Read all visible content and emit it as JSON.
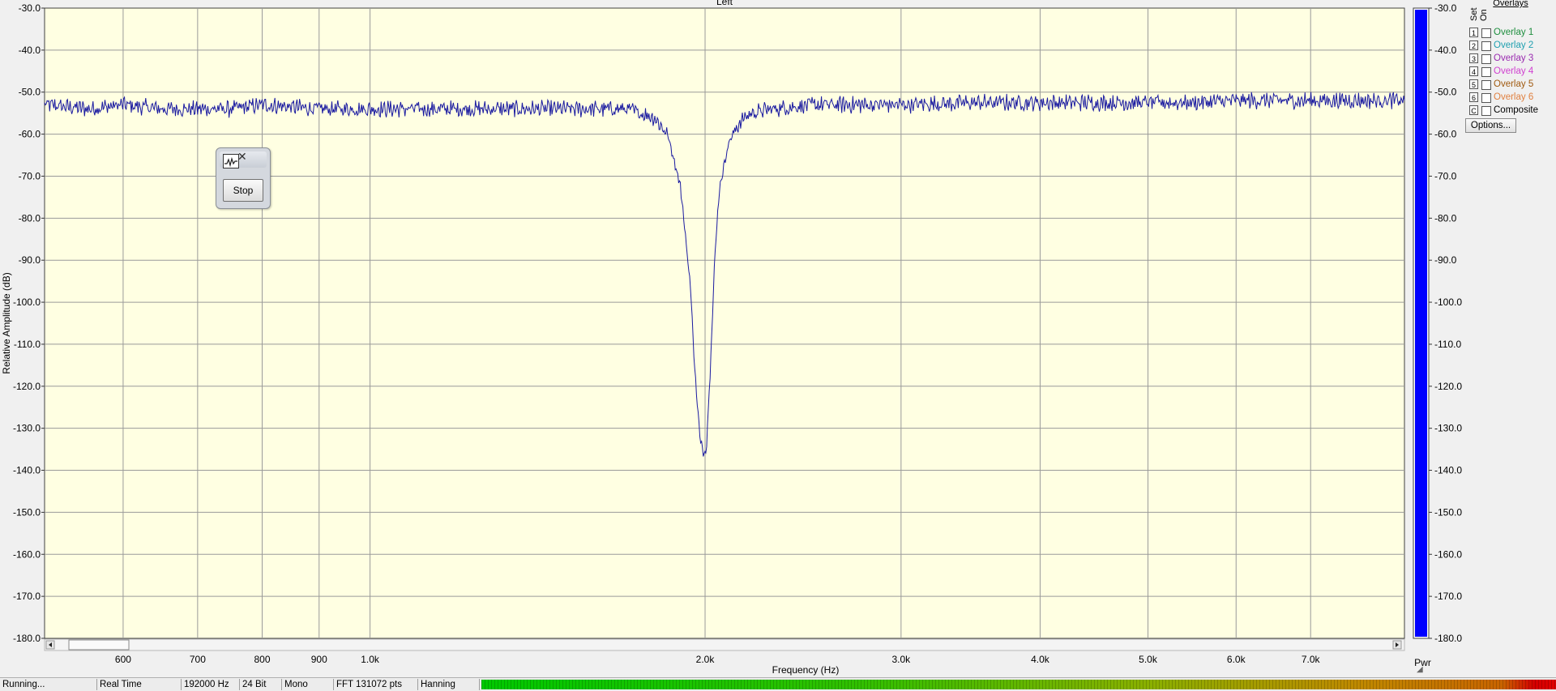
{
  "window": {
    "chart_title": "Left"
  },
  "chart_data": {
    "type": "line",
    "title": "Left",
    "xlabel": "Frequency (Hz)",
    "ylabel": "Relative Amplitude (dB)",
    "x_scale": "log",
    "xlim": [
      510,
      8500
    ],
    "ylim": [
      -180,
      -30
    ],
    "x_ticks": [
      {
        "value": 600,
        "label": "600"
      },
      {
        "value": 700,
        "label": "700"
      },
      {
        "value": 800,
        "label": "800"
      },
      {
        "value": 900,
        "label": "900"
      },
      {
        "value": 1000,
        "label": "1.0k"
      },
      {
        "value": 2000,
        "label": "2.0k"
      },
      {
        "value": 3000,
        "label": "3.0k"
      },
      {
        "value": 4000,
        "label": "4.0k"
      },
      {
        "value": 5000,
        "label": "5.0k"
      },
      {
        "value": 6000,
        "label": "6.0k"
      },
      {
        "value": 7000,
        "label": "7.0k"
      }
    ],
    "y_ticks": [
      {
        "value": -30,
        "label": "-30.0"
      },
      {
        "value": -40,
        "label": "-40.0"
      },
      {
        "value": -50,
        "label": "-50.0"
      },
      {
        "value": -60,
        "label": "-60.0"
      },
      {
        "value": -70,
        "label": "-70.0"
      },
      {
        "value": -80,
        "label": "-80.0"
      },
      {
        "value": -90,
        "label": "-90.0"
      },
      {
        "value": -100,
        "label": "-100.0"
      },
      {
        "value": -110,
        "label": "-110.0"
      },
      {
        "value": -120,
        "label": "-120.0"
      },
      {
        "value": -130,
        "label": "-130.0"
      },
      {
        "value": -140,
        "label": "-140.0"
      },
      {
        "value": -150,
        "label": "-150.0"
      },
      {
        "value": -160,
        "label": "-160.0"
      },
      {
        "value": -170,
        "label": "-170.0"
      },
      {
        "value": -180,
        "label": "-180.0"
      }
    ],
    "grid": true,
    "series": [
      {
        "color": "#1a1aa0",
        "x": [
          510,
          560,
          600,
          650,
          700,
          750,
          800,
          900,
          1000,
          1100,
          1200,
          1300,
          1400,
          1500,
          1600,
          1700,
          1800,
          1850,
          1900,
          1940,
          1960,
          1980,
          1995,
          2005,
          2020,
          2040,
          2060,
          2100,
          2150,
          2200,
          2300,
          2500,
          2750,
          3000,
          3500,
          4000,
          4500,
          5000,
          5500,
          6000,
          6500,
          7000,
          7500,
          8000,
          8500
        ],
        "y": [
          -53,
          -54,
          -53,
          -54,
          -54,
          -54,
          -53,
          -54,
          -54,
          -54,
          -54,
          -54,
          -54,
          -54,
          -54,
          -54,
          -56,
          -60,
          -72,
          -96,
          -118,
          -133,
          -136,
          -135,
          -118,
          -90,
          -73,
          -62,
          -57,
          -55,
          -54,
          -53,
          -53,
          -53,
          -52.5,
          -52.5,
          -52.5,
          -52.5,
          -52.5,
          -52,
          -52,
          -52,
          -52,
          -52,
          -52
        ]
      }
    ]
  },
  "power_meter": {
    "label": "Pwr",
    "ylim": [
      -180,
      -30
    ],
    "level": -30,
    "ticks": [
      "-30.0",
      "-40.0",
      "-50.0",
      "-60.0",
      "-70.0",
      "-80.0",
      "-90.0",
      "-100.0",
      "-110.0",
      "-120.0",
      "-130.0",
      "-140.0",
      "-150.0",
      "-160.0",
      "-170.0",
      "-180.0"
    ]
  },
  "toolbar_panel": {
    "stop_label": "Stop",
    "icon": "waveform-icon",
    "close_icon": "close-icon"
  },
  "overlays": {
    "title": "Overlays",
    "header_set": "Set",
    "header_on": "On",
    "items": [
      {
        "num": "1",
        "label": "Overlay 1",
        "color": "#1e8e3e"
      },
      {
        "num": "2",
        "label": "Overlay 2",
        "color": "#20a0b0"
      },
      {
        "num": "3",
        "label": "Overlay 3",
        "color": "#9a2ab0"
      },
      {
        "num": "4",
        "label": "Overlay 4",
        "color": "#d040d0"
      },
      {
        "num": "5",
        "label": "Overlay 5",
        "color": "#a05a10"
      },
      {
        "num": "6",
        "label": "Overlay 6",
        "color": "#e08040"
      },
      {
        "num": "C",
        "label": "Composite",
        "color": "#000000"
      }
    ],
    "options_label": "Options..."
  },
  "status_bar": {
    "state": "Running...",
    "mode": "Real Time",
    "sample_rate": "192000 Hz",
    "bit_depth": "24 Bit",
    "channels": "Mono",
    "fft": "FFT 131072 pts",
    "window_fn": "Hanning"
  },
  "colors": {
    "plot_bg": "#ffffe2",
    "grid": "#9a9a9a",
    "trace": "#1a1aa0",
    "power_bar": "#0000ff"
  }
}
